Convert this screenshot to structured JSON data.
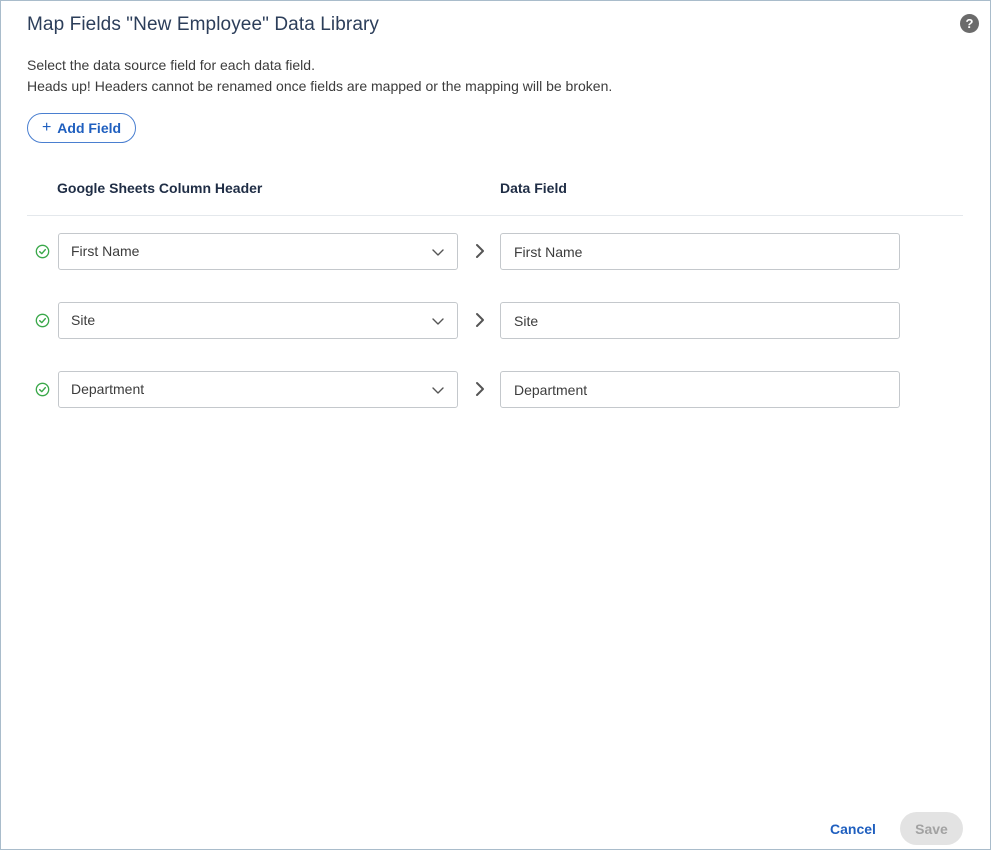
{
  "dialog": {
    "title": "Map Fields \"New Employee\" Data Library",
    "help_icon_glyph": "?",
    "description_line1": "Select the data source field for each data field.",
    "description_line2": "Heads up! Headers cannot be renamed once fields are mapped or the mapping will be broken."
  },
  "toolbar": {
    "add_field_plus": "+",
    "add_field_label": "Add Field"
  },
  "columns": {
    "source_header": "Google Sheets Column Header",
    "target_header": "Data Field"
  },
  "mappings": [
    {
      "source": "First Name",
      "target": "First Name",
      "status": "mapped"
    },
    {
      "source": "Site",
      "target": "Site",
      "status": "mapped"
    },
    {
      "source": "Department",
      "target": "Department",
      "status": "mapped"
    }
  ],
  "footer": {
    "cancel_label": "Cancel",
    "save_label": "Save"
  },
  "colors": {
    "accent": "#1f5fbf",
    "check_green": "#3aa84a",
    "title": "#2c3e5a"
  },
  "icons": {
    "help": "help-icon",
    "add": "plus-icon",
    "status": "check-circle-icon",
    "dropdown": "chevron-down-icon",
    "map_arrow": "chevron-right-icon"
  }
}
